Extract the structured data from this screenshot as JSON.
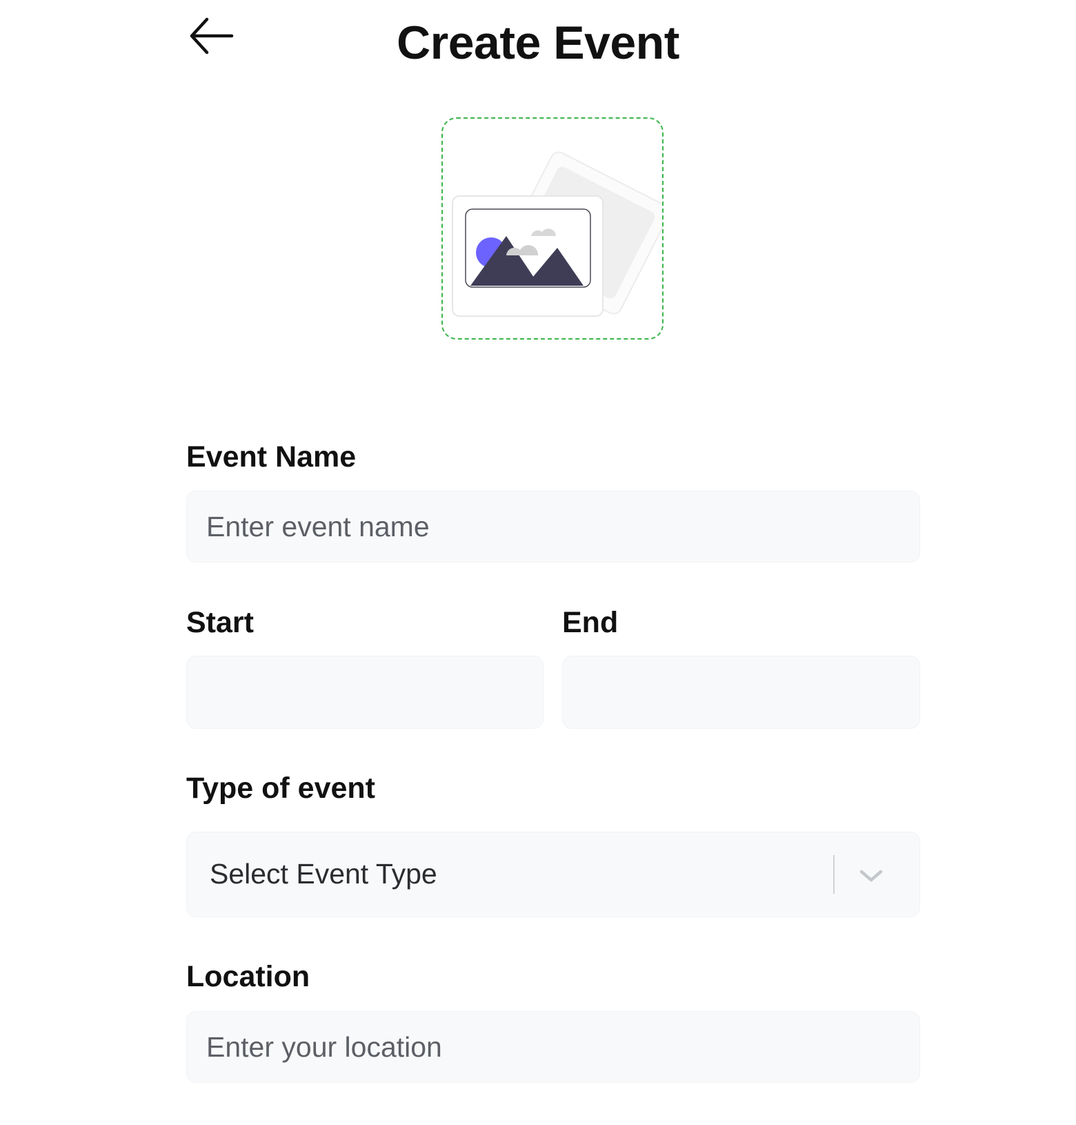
{
  "header": {
    "title": "Create Event",
    "back_icon": "arrow-left-icon"
  },
  "upload": {
    "icon": "image-placeholder-icon",
    "border_color": "#3bb54a",
    "accent_color": "#6c63ff",
    "mountain_color": "#3f3d56"
  },
  "form": {
    "event_name": {
      "label": "Event Name",
      "placeholder": "Enter event name",
      "value": ""
    },
    "start": {
      "label": "Start",
      "value": ""
    },
    "end": {
      "label": "End",
      "value": ""
    },
    "event_type": {
      "label": "Type of event",
      "selected": "Select Event Type",
      "icon": "chevron-down-icon"
    },
    "location": {
      "label": "Location",
      "placeholder": "Enter your location",
      "value": ""
    }
  }
}
